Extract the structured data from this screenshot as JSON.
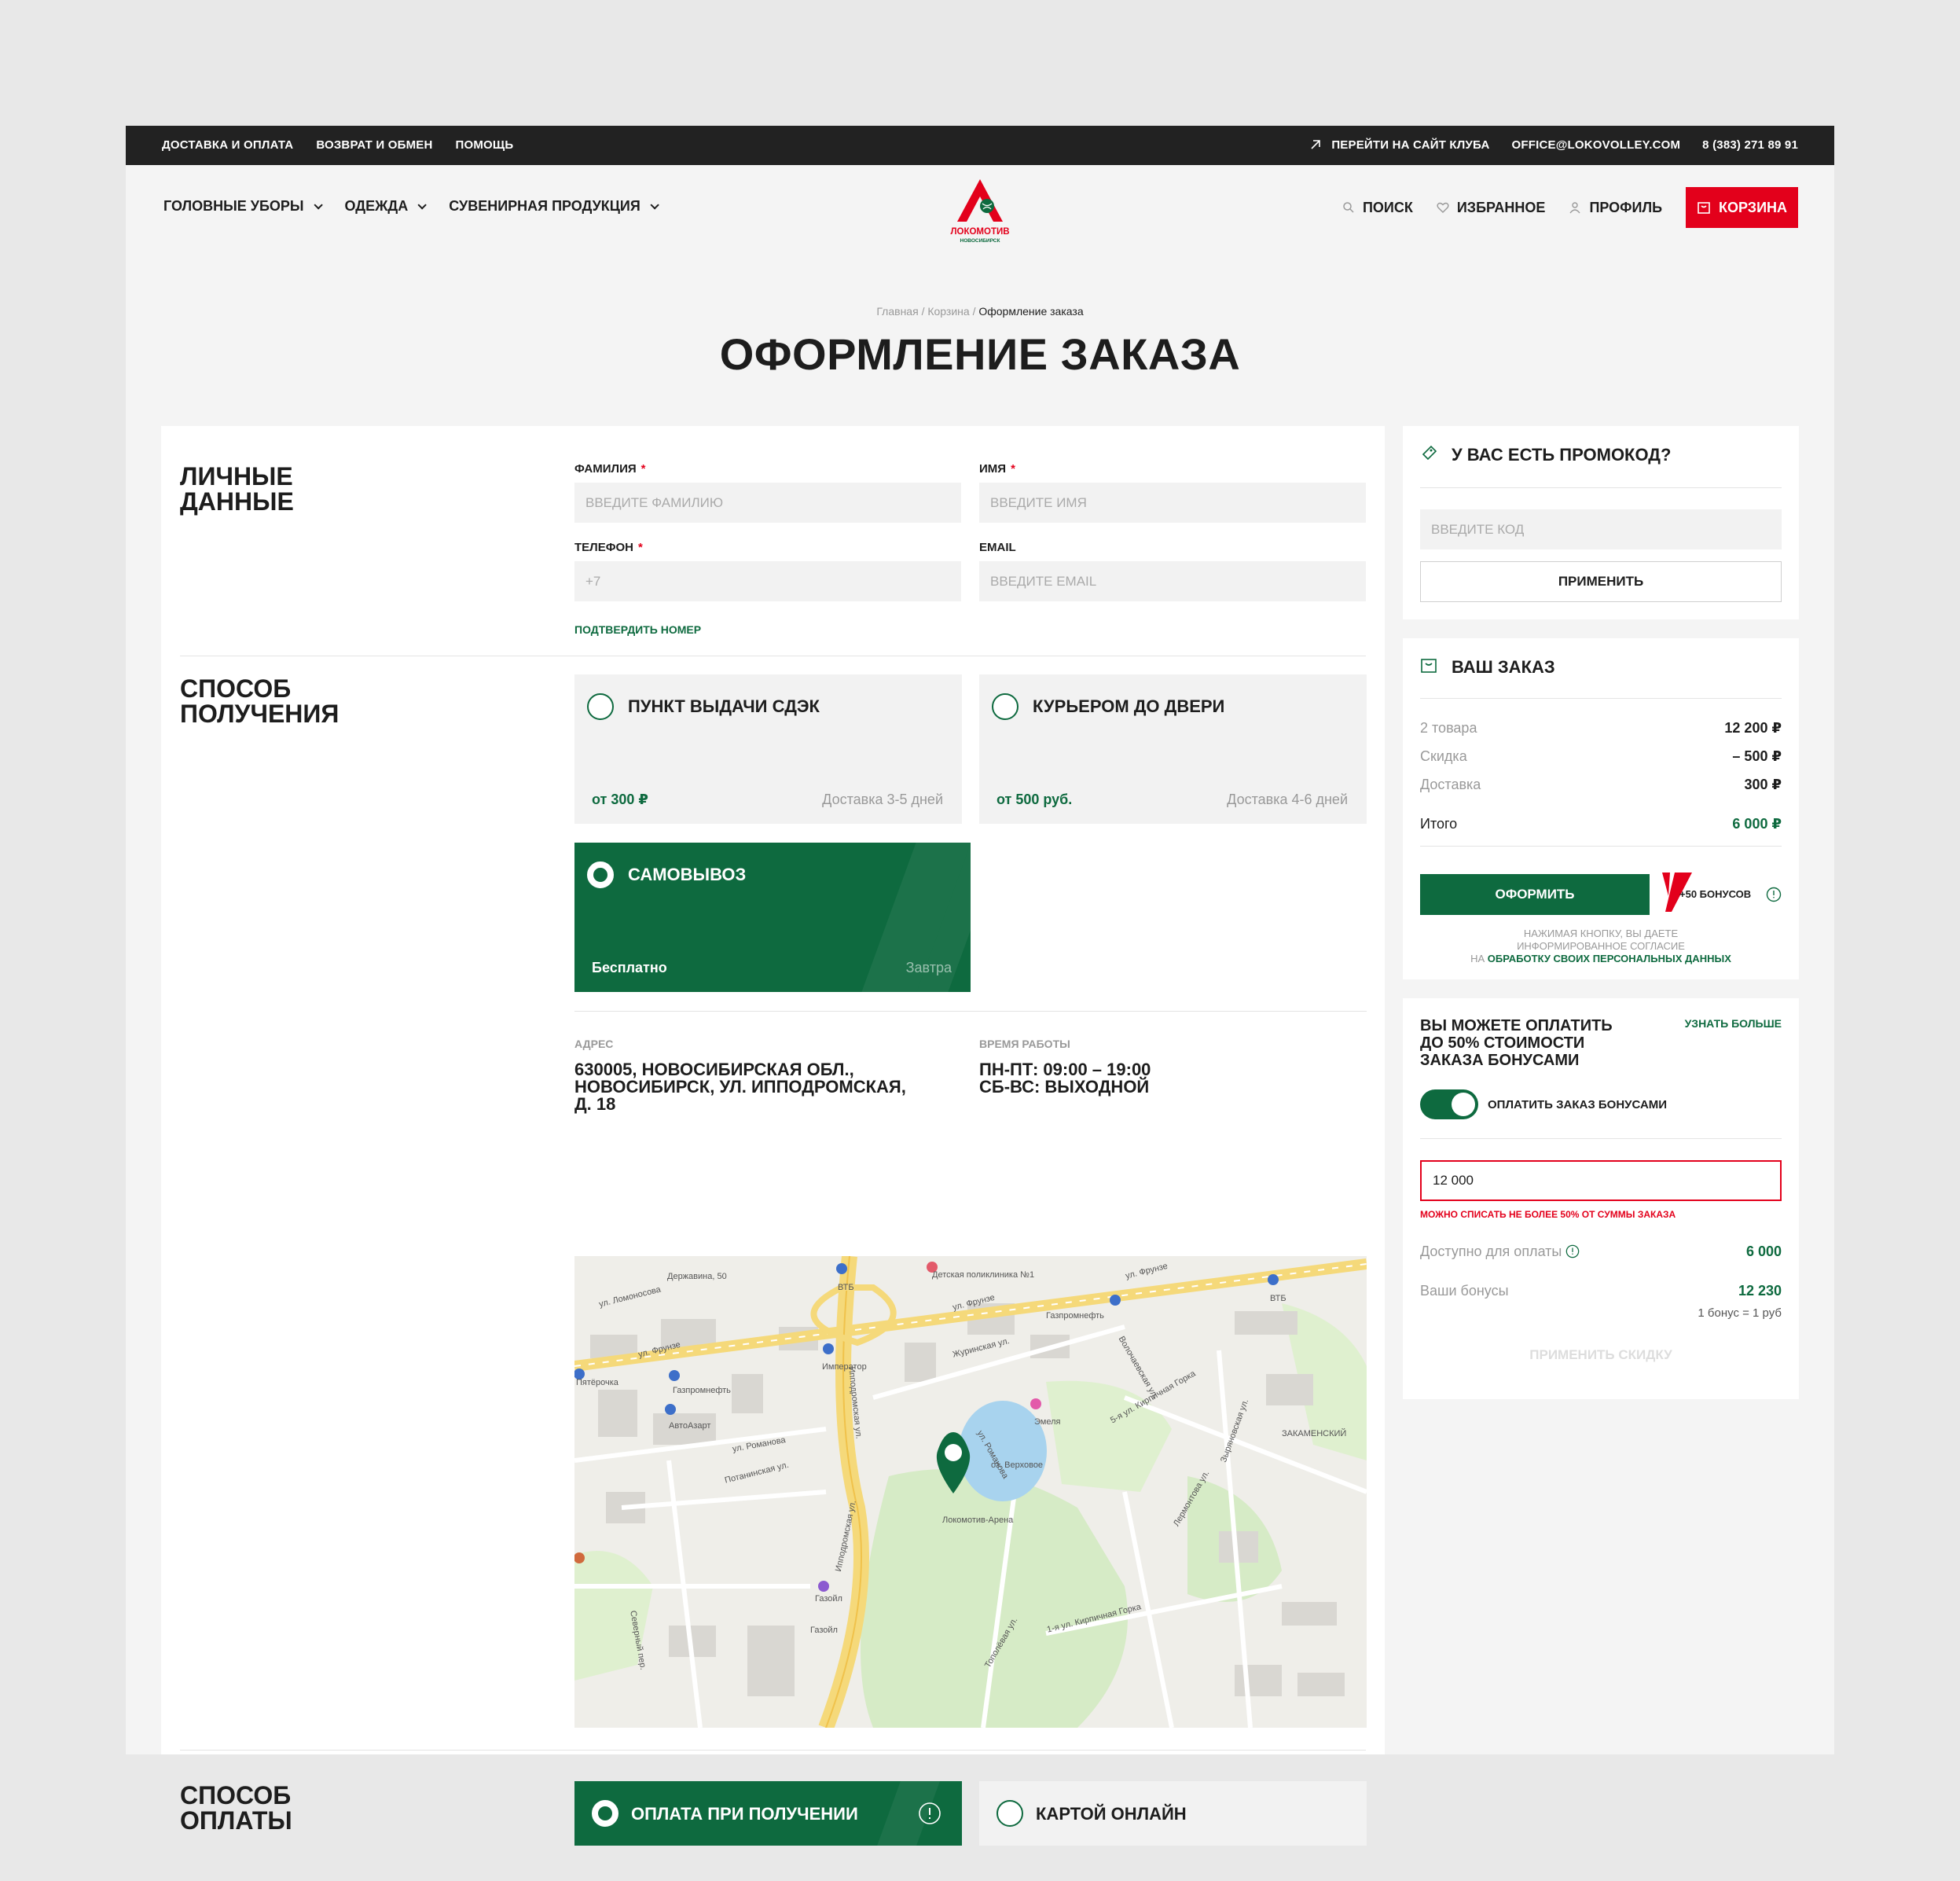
{
  "topbar": {
    "links": [
      "Доставка и оплата",
      "Возврат и обмен",
      "Помощь"
    ],
    "club_link": "Перейти на сайт клуба",
    "email": "office@lokovolley.com",
    "phone": "8 (383) 271 89 91"
  },
  "nav": {
    "left": [
      "Головные уборы",
      "Одежда",
      "Сувенирная продукция"
    ],
    "logo_text": "Локомотив",
    "logo_sub": "Новосибирск",
    "search": "Поиск",
    "favorites": "Избранное",
    "profile": "Профиль",
    "cart": "Корзина"
  },
  "breadcrumb": {
    "home": "Главная",
    "sep": "/",
    "cart": "Корзина",
    "current": "Оформление заказа"
  },
  "page_title": "Оформление заказа",
  "personal": {
    "title_line1": "Личные",
    "title_line2": "данные",
    "last_name_label": "Фамилия",
    "last_name_placeholder": "Введите фамилию",
    "first_name_label": "Имя",
    "first_name_placeholder": "Введите имя",
    "phone_label": "Телефон",
    "phone_placeholder": "+7",
    "email_label": "Email",
    "email_placeholder": "Введите email",
    "required_mark": "*",
    "confirm_phone": "Подтвердить номер"
  },
  "delivery": {
    "title_line1": "Способ",
    "title_line2": "получения",
    "options": [
      {
        "name": "Пункт выдачи СДЭК",
        "price": "от 300 ₽",
        "eta": "Доставка 3-5 дней"
      },
      {
        "name": "Курьером до двери",
        "price": "от 500 руб.",
        "eta": "Доставка 4-6 дней"
      },
      {
        "name": "Самовывоз",
        "price": "Бесплатно",
        "eta": "Завтра"
      }
    ],
    "address_label": "Адрес",
    "address_lines": [
      "630005, Новосибирская обл.,",
      "Новосибирск, ул. Ипподромская,",
      "д. 18"
    ],
    "hours_label": "Время работы",
    "hours_lines": [
      "пн-пт: 09:00 – 19:00",
      "сб-вс: выходной"
    ]
  },
  "map": {
    "labels": [
      "ул. Фрунзе",
      "ул. Фрунзе",
      "ул. Фрунзе",
      "Ипподромская ул.",
      "Ипподромская ул.",
      "Журинская ул.",
      "ул. Романова",
      "ул. Романова",
      "Потанинская ул.",
      "оз. Верховое",
      "Локомотив-Арена",
      "Газпромнефть",
      "Газпромнефть",
      "Детская поликлиника №1",
      "ВТБ",
      "ВТБ",
      "Эмеля",
      "Император",
      "АвтоАзарт",
      "Газойл",
      "Газойл",
      "Пятёрочка",
      "ул. Ломоносова",
      "Державина, 50",
      "ЗАКАМЕНСКИЙ",
      "5-я ул. Кирпичная Горка",
      "1-я ул. Кирпичная Горка",
      "Тополёвая ул.",
      "Волочаевская ул.",
      "Лермонтова ул.",
      "Зыряновская ул.",
      "Северный пер."
    ]
  },
  "payment": {
    "title_line1": "Способ",
    "title_line2": "оплаты",
    "options": [
      "Оплата при получении",
      "Картой онлайн"
    ]
  },
  "promo": {
    "title": "У вас есть промокод?",
    "placeholder": "Введите код",
    "apply": "Применить"
  },
  "order": {
    "title": "Ваш заказ",
    "rows": [
      {
        "k": "2 товара",
        "v": "12 200 ₽"
      },
      {
        "k": "Скидка",
        "v": "– 500 ₽"
      },
      {
        "k": "Доставка",
        "v": "300 ₽"
      }
    ],
    "total_label": "Итого",
    "total_value": "6 000 ₽",
    "checkout": "Оформить",
    "bonus": "+50 бонусов",
    "consent_line1": "Нажимая кнопку, вы даете",
    "consent_line2": "информированное согласие",
    "consent_pre": "на",
    "consent_link": "обработку своих персональных данных"
  },
  "bonuses": {
    "title_lines": [
      "Вы можете оплатить",
      "до 50% стоимости",
      "заказа бонусами"
    ],
    "learn_more": "Узнать больше",
    "toggle_label": "Оплатить заказ бонусами",
    "toggle_on": true,
    "input_value": "12 000",
    "error": "Можно списать не более 50% от суммы заказа",
    "available_label": "Доступно для оплаты",
    "available_value": "6 000",
    "your_label": "Ваши бонусы",
    "your_value": "12 230",
    "rate": "1 бонус = 1 руб",
    "apply_discount": "Применить скидку"
  },
  "colors": {
    "green": "#0e6a3f",
    "red": "#e3001b",
    "dark": "#222222"
  }
}
